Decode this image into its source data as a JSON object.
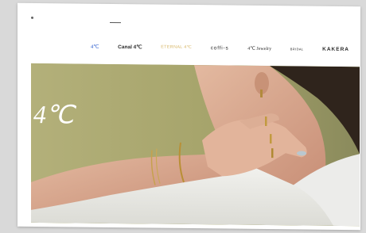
{
  "header": {
    "nav_items": [
      {
        "label": "4℃"
      },
      {
        "label": "Canal 4℃"
      },
      {
        "label": "ETERNAL 4℃"
      },
      {
        "label": "coffi-s"
      },
      {
        "label": "4℃ Jewelry"
      },
      {
        "label": "BRIDAL"
      },
      {
        "label": "KAKERA"
      }
    ]
  },
  "hero": {
    "logo": "4℃"
  },
  "colors": {
    "brand_blue": "#2f5fd0",
    "eternal_gold": "#d8b86a",
    "hero_background": "#a7a76c"
  }
}
